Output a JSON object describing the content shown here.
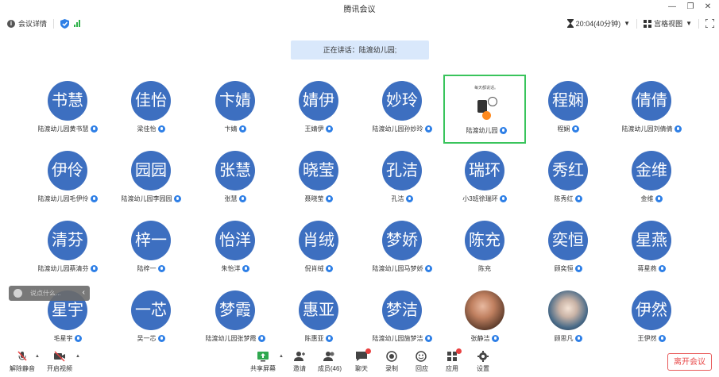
{
  "window": {
    "title": "腾讯会议"
  },
  "toolbar": {
    "details_label": "会议详情",
    "time": "20:04(40分钟)",
    "view_label": "宫格视图"
  },
  "speaking": {
    "text": "正在讲话：陆渡幼儿园;"
  },
  "participants": [
    {
      "avatar": "书慧",
      "name": "陆渡幼儿园黄书慧",
      "mic": true
    },
    {
      "avatar": "佳怡",
      "name": "梁佳怡",
      "mic": true
    },
    {
      "avatar": "卞婧",
      "name": "卞婧",
      "mic": true
    },
    {
      "avatar": "婧伊",
      "name": "王婧伊",
      "mic": true
    },
    {
      "avatar": "妙玲",
      "name": "陆渡幼儿园孙妙玲",
      "mic": true
    },
    {
      "avatar": "",
      "name": "陆渡幼儿园",
      "mic": true,
      "screen": true
    },
    {
      "avatar": "程娴",
      "name": "程娴",
      "mic": true
    },
    {
      "avatar": "倩倩",
      "name": "陆渡幼儿园刘倩倩",
      "mic": true
    },
    {
      "avatar": "伊伶",
      "name": "陆渡幼儿园毛伊伶",
      "mic": true
    },
    {
      "avatar": "园园",
      "name": "陆渡幼儿园李园园",
      "mic": true
    },
    {
      "avatar": "张慧",
      "name": "张慧",
      "mic": true
    },
    {
      "avatar": "晓莹",
      "name": "聂晓莹",
      "mic": true
    },
    {
      "avatar": "孔洁",
      "name": "孔洁",
      "mic": true
    },
    {
      "avatar": "瑞环",
      "name": "小3班徐瑞环",
      "mic": true
    },
    {
      "avatar": "秀红",
      "name": "陈秀红",
      "mic": true
    },
    {
      "avatar": "金维",
      "name": "金维",
      "mic": true
    },
    {
      "avatar": "清芬",
      "name": "陆渡幼儿园蔡清芬",
      "mic": true
    },
    {
      "avatar": "梓一",
      "name": "陆梓一",
      "mic": true
    },
    {
      "avatar": "怡洋",
      "name": "朱怡洋",
      "mic": true
    },
    {
      "avatar": "肖绒",
      "name": "倪肖绒",
      "mic": true
    },
    {
      "avatar": "梦娇",
      "name": "陆渡幼儿园马梦娇",
      "mic": true
    },
    {
      "avatar": "陈充",
      "name": "陈充",
      "mic": false
    },
    {
      "avatar": "奕恒",
      "name": "顾奕恒",
      "mic": true
    },
    {
      "avatar": "星燕",
      "name": "蒋星燕",
      "mic": true
    },
    {
      "avatar": "星宇",
      "name": "毛星宇",
      "mic": true
    },
    {
      "avatar": "一芯",
      "name": "吴一芯",
      "mic": true
    },
    {
      "avatar": "梦霞",
      "name": "陆渡幼儿园张梦霞",
      "mic": true
    },
    {
      "avatar": "惠亚",
      "name": "陈惠亚",
      "mic": true
    },
    {
      "avatar": "梦洁",
      "name": "陆渡幼儿园施梦洁",
      "mic": true
    },
    {
      "avatar": "",
      "name": "张静洁",
      "mic": true,
      "photo": "photo1"
    },
    {
      "avatar": "",
      "name": "顾思凡",
      "mic": true,
      "photo": "photo2"
    },
    {
      "avatar": "伊然",
      "name": "王伊然",
      "mic": true
    }
  ],
  "screen_share": {
    "caption": "每天都说话。"
  },
  "chat": {
    "placeholder": "说点什么..."
  },
  "bottom": {
    "unmute": "解除静音",
    "video": "开启视频",
    "share": "共享屏幕",
    "invite": "邀请",
    "members": "成员(46)",
    "chat": "聊天",
    "record": "录制",
    "react": "回应",
    "apps": "应用",
    "settings": "设置",
    "leave": "离开会议"
  },
  "colors": {
    "avatar_bg": "#3d6fc0",
    "active_border": "#39c45c",
    "leave_red": "#e84a4a",
    "mic_blue": "#2e7fe6"
  }
}
